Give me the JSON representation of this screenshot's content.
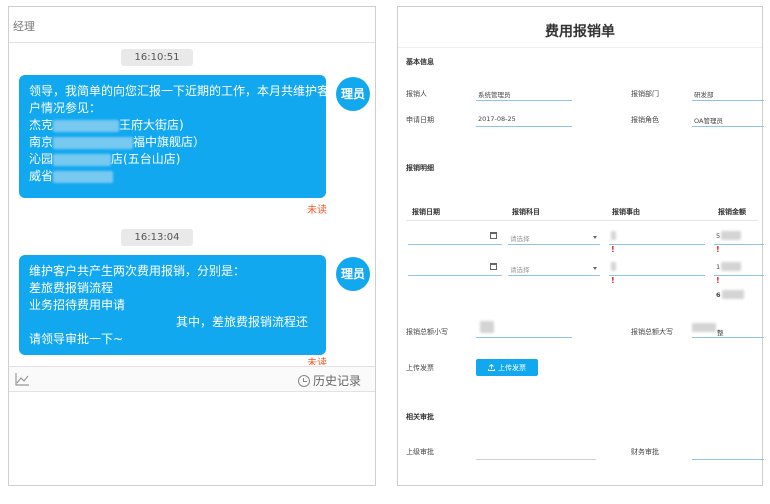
{
  "chat": {
    "header_title": "经理",
    "messages": [
      {
        "time": "16:10:51",
        "lines": [
          "领导，我简单的向您汇报一下近期的工作，本月共维护客",
          "户情况参见："
        ],
        "clients": [
          {
            "prefix": "杰克",
            "suffix": "王府大街店)"
          },
          {
            "prefix": "南京",
            "suffix": "福中旗舰店）"
          },
          {
            "prefix": "沁园",
            "suffix": "店(五台山店)"
          },
          {
            "prefix": "威省",
            "suffix": ""
          }
        ],
        "avatar": "理员",
        "status": "未读"
      },
      {
        "time": "16:13:04",
        "lines": [
          "维护客户共产生两次费用报销，分别是：",
          "差旅费报销流程",
          "业务招待费用申请"
        ],
        "right_line": "其中，差旅费报销流程还",
        "last_line": "请领导审批一下~",
        "avatar": "理员",
        "status": "未读"
      }
    ],
    "toolbar": {
      "chart_icon": "line-chart-icon",
      "history_label": "历史记录",
      "history_icon": "clock-icon"
    }
  },
  "form": {
    "title": "费用报销单",
    "basic_section": "基本信息",
    "fields": {
      "applicant_label": "报销人",
      "applicant_value": "系统管理员",
      "dept_label": "报销部门",
      "dept_value": "研发部",
      "date_label": "申请日期",
      "date_value": "2017-08-25",
      "role_label": "报销角色",
      "role_value": "OA管理员"
    },
    "detail_section": "报销明细",
    "table": {
      "headers": [
        "报销日期",
        "报销科目",
        "报销事由",
        "报销金额"
      ],
      "select_placeholder": "请选择",
      "rows": [
        {
          "amount_prefix": "5"
        },
        {
          "amount_prefix": "1"
        }
      ],
      "total_prefix": "6"
    },
    "total_small_label": "报销总额小写",
    "total_big_label": "报销总额大写",
    "total_big_suffix": "整",
    "upload_label": "上传发票",
    "upload_button": "上传发票",
    "approval_section": "相关审批",
    "superior_label": "上级审批",
    "finance_label": "财务审批",
    "error_mark": "!",
    "colors": {
      "accent": "#12a8f0",
      "unread": "#f15a24",
      "error": "#e02020"
    }
  }
}
